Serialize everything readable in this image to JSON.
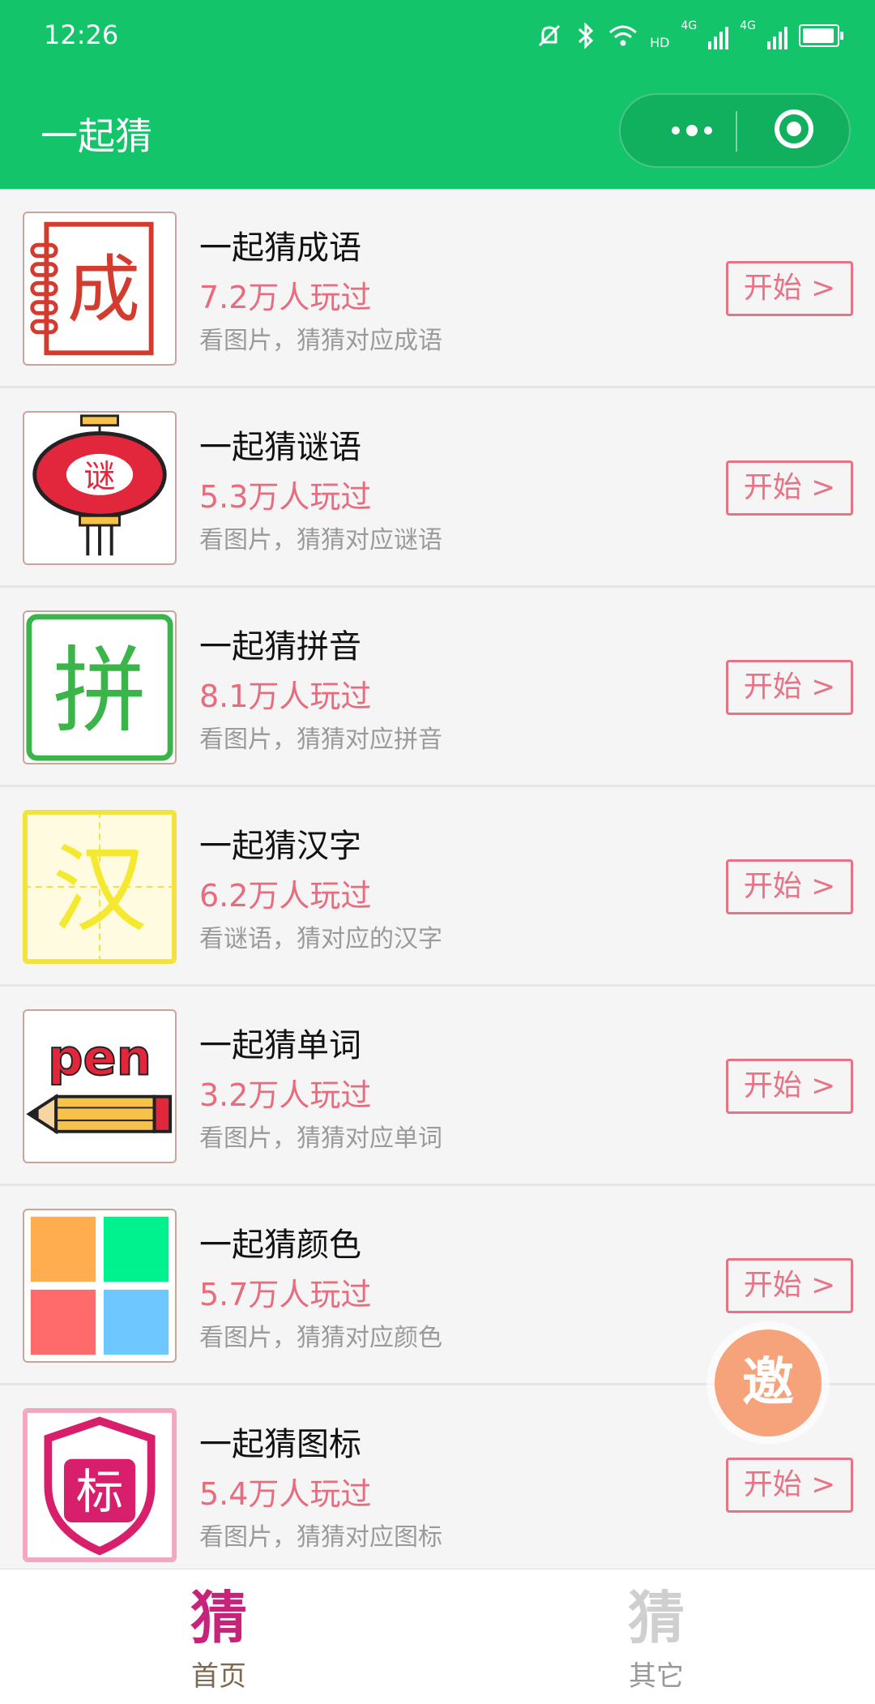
{
  "status_bar": {
    "time": "12:26",
    "net1": "4G",
    "net2": "4G",
    "hd": "HD"
  },
  "nav": {
    "title": "一起猜"
  },
  "colors": {
    "header": "#13c46a",
    "accent_pink": "#e86b7e",
    "button_border": "#e67386"
  },
  "start_label": "开始 >",
  "items": [
    {
      "title": "一起猜成语",
      "plays": "7.2万人玩过",
      "desc": "看图片，猜猜对应成语",
      "icon": "idiom-icon",
      "icon_char": "成"
    },
    {
      "title": "一起猜谜语",
      "plays": "5.3万人玩过",
      "desc": "看图片，猜猜对应谜语",
      "icon": "riddle-lantern-icon",
      "icon_char": "谜"
    },
    {
      "title": "一起猜拼音",
      "plays": "8.1万人玩过",
      "desc": "看图片，猜猜对应拼音",
      "icon": "pinyin-icon",
      "icon_char": "拼"
    },
    {
      "title": "一起猜汉字",
      "plays": "6.2万人玩过",
      "desc": "看谜语，猜对应的汉字",
      "icon": "hanzi-icon",
      "icon_char": "汉"
    },
    {
      "title": "一起猜单词",
      "plays": "3.2万人玩过",
      "desc": "看图片，猜猜对应单词",
      "icon": "word-pen-icon",
      "icon_char": "pen"
    },
    {
      "title": "一起猜颜色",
      "plays": "5.7万人玩过",
      "desc": "看图片，猜猜对应颜色",
      "icon": "color-grid-icon"
    },
    {
      "title": "一起猜图标",
      "plays": "5.4万人玩过",
      "desc": "看图片，猜猜对应图标",
      "icon": "logo-shield-icon",
      "icon_char": "标"
    }
  ],
  "invite": {
    "char": "邀"
  },
  "tabbar": {
    "home": {
      "icon_char": "猜",
      "label": "首页"
    },
    "other": {
      "icon_char": "猜",
      "label": "其它"
    }
  }
}
